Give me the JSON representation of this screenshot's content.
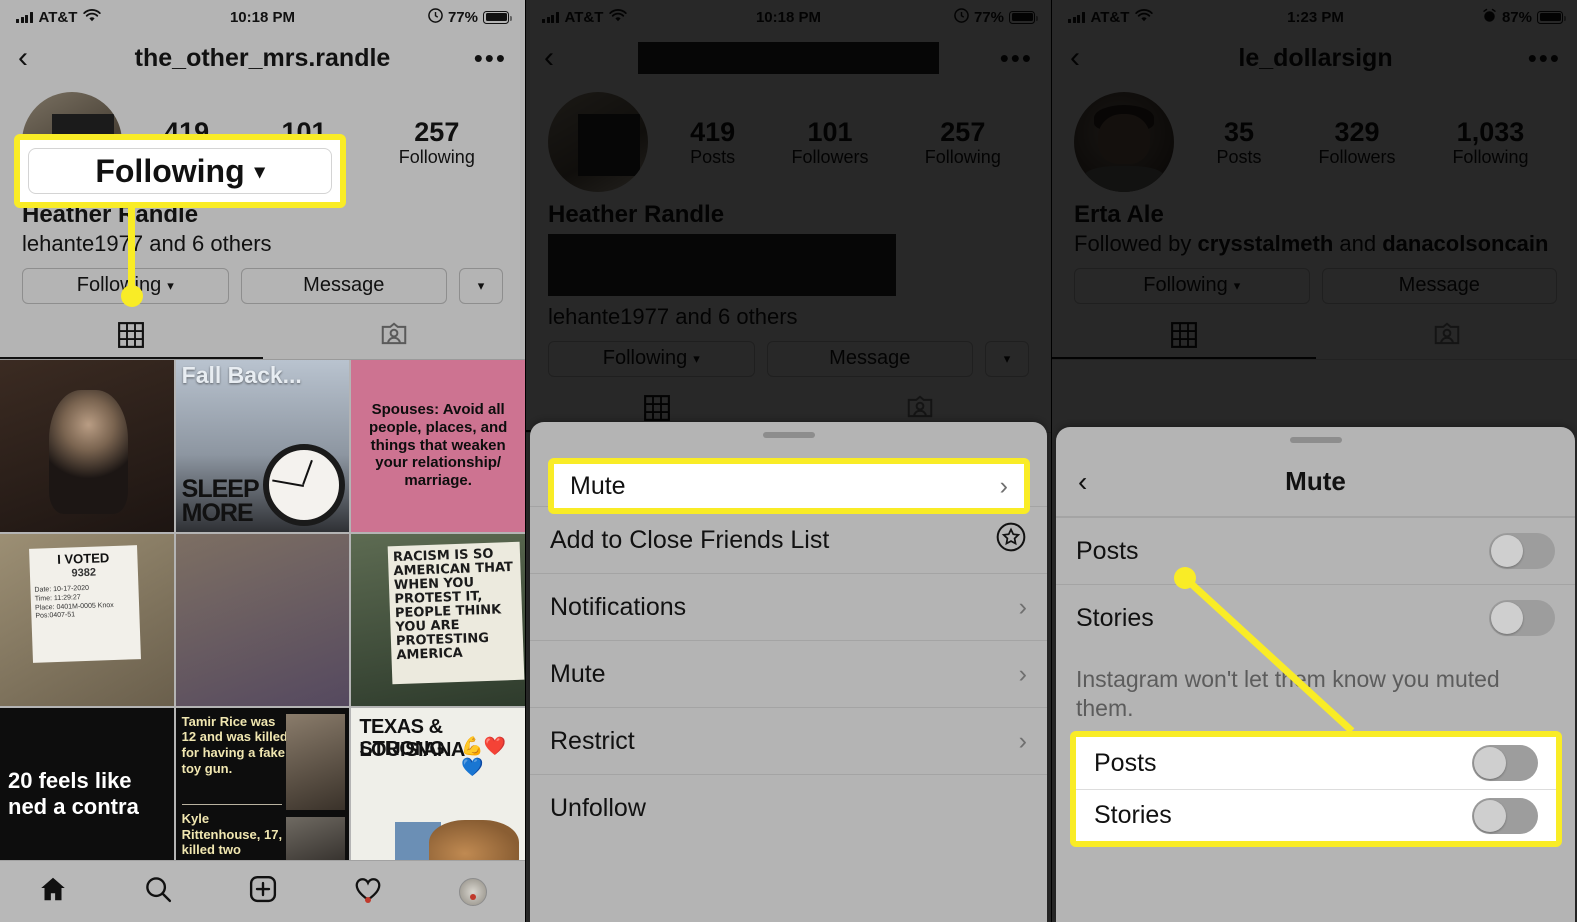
{
  "panels": [
    {
      "id": "panel-profile-following",
      "statusbar": {
        "carrier": "AT&T",
        "time": "10:18 PM",
        "battery": "77%"
      },
      "nav": {
        "title": "the_other_mrs.randle",
        "back_icon": "chevron-left-icon",
        "more_icon": "ellipsis-icon"
      },
      "stats": [
        {
          "num": "419",
          "label": "Posts"
        },
        {
          "num": "101",
          "label": "Followers"
        },
        {
          "num": "257",
          "label": "Following"
        }
      ],
      "bio": {
        "name": "Heather Randle",
        "followed_by": "lehante1977 and 6 others"
      },
      "actions": {
        "following": "Following",
        "message": "Message"
      },
      "highlight": {
        "label": "Following"
      },
      "posts": [
        {
          "caption": "",
          "kind": "preacher"
        },
        {
          "caption": "Fall Back...",
          "caption2": "SLEEP MORE",
          "kind": "clock"
        },
        {
          "caption": "Spouses: Avoid all people, places, and things that weaken your relationship/ marriage.",
          "kind": "pink"
        },
        {
          "caption": "I VOTED",
          "sub": "9382",
          "kind": "vote"
        },
        {
          "caption": "",
          "kind": "baby"
        },
        {
          "caption": "RACISM IS SO AMERICAN THAT WHEN YOU PROTEST IT, PEOPLE THINK YOU ARE PROTESTING AMERICA",
          "kind": "protest"
        },
        {
          "caption": "20 feels like ned a contra",
          "kind": "black"
        },
        {
          "caption": "Tamir Rice was 12 and was killed for having a fake toy gun.",
          "caption2": "Kyle Rittenhouse, 17, killed two",
          "kind": "news"
        },
        {
          "caption": "TEXAS & LOUISIANA",
          "caption2": "STRONG",
          "kind": "texas"
        }
      ],
      "bottomnav": [
        "home-icon",
        "search-icon",
        "add-post-icon",
        "activity-heart-icon",
        "profile-avatar-icon"
      ]
    },
    {
      "id": "panel-action-sheet",
      "statusbar": {
        "carrier": "AT&T",
        "time": "10:18 PM",
        "battery": "77%"
      },
      "nav": {
        "title": "",
        "back_icon": "chevron-left-icon",
        "more_icon": "ellipsis-icon"
      },
      "stats": [
        {
          "num": "419",
          "label": "Posts"
        },
        {
          "num": "101",
          "label": "Followers"
        },
        {
          "num": "257",
          "label": "Following"
        }
      ],
      "bio": {
        "name": "Heather Randle",
        "followed_by": "lehante1977 and 6 others"
      },
      "actions": {
        "following": "Following",
        "message": "Message"
      },
      "highlight": {
        "label": "Mute"
      },
      "sheet_items": [
        {
          "label": "Mute",
          "accessory": "chevron-right-icon"
        },
        {
          "label": "Add to Close Friends List",
          "accessory": "star-circle-icon"
        },
        {
          "label": "Notifications",
          "accessory": "chevron-right-icon"
        },
        {
          "label": "Mute",
          "accessory": "chevron-right-icon"
        },
        {
          "label": "Restrict",
          "accessory": "chevron-right-icon"
        },
        {
          "label": "Unfollow",
          "accessory": "none"
        }
      ]
    },
    {
      "id": "panel-mute-settings",
      "statusbar": {
        "carrier": "AT&T",
        "time": "1:23 PM",
        "battery": "87%"
      },
      "nav": {
        "title": "le_dollarsign",
        "back_icon": "chevron-left-icon",
        "more_icon": "ellipsis-icon"
      },
      "stats": [
        {
          "num": "35",
          "label": "Posts"
        },
        {
          "num": "329",
          "label": "Followers"
        },
        {
          "num": "1,033",
          "label": "Following"
        }
      ],
      "bio": {
        "name": "Erta Ale",
        "followed_by_prefix": "Followed by ",
        "followed_by_bold": "crysstalmeth",
        "followed_by_mid": " and ",
        "followed_by_bold2": "danacolsoncain"
      },
      "actions": {
        "following": "Following",
        "message": "Message"
      },
      "sheet": {
        "title": "Mute",
        "back_icon": "chevron-left-icon",
        "rows": [
          {
            "label": "Posts",
            "toggle": "off"
          },
          {
            "label": "Stories",
            "toggle": "off"
          }
        ],
        "note": "Instagram won't let them know you muted them."
      },
      "highlight": {
        "rows": [
          {
            "label": "Posts",
            "toggle": "off"
          },
          {
            "label": "Stories",
            "toggle": "off"
          }
        ]
      }
    }
  ],
  "colors": {
    "highlight": "#f9ec26",
    "panel_bg": "#b4b4b4",
    "dim": "rgba(0,0,0,.78)"
  }
}
